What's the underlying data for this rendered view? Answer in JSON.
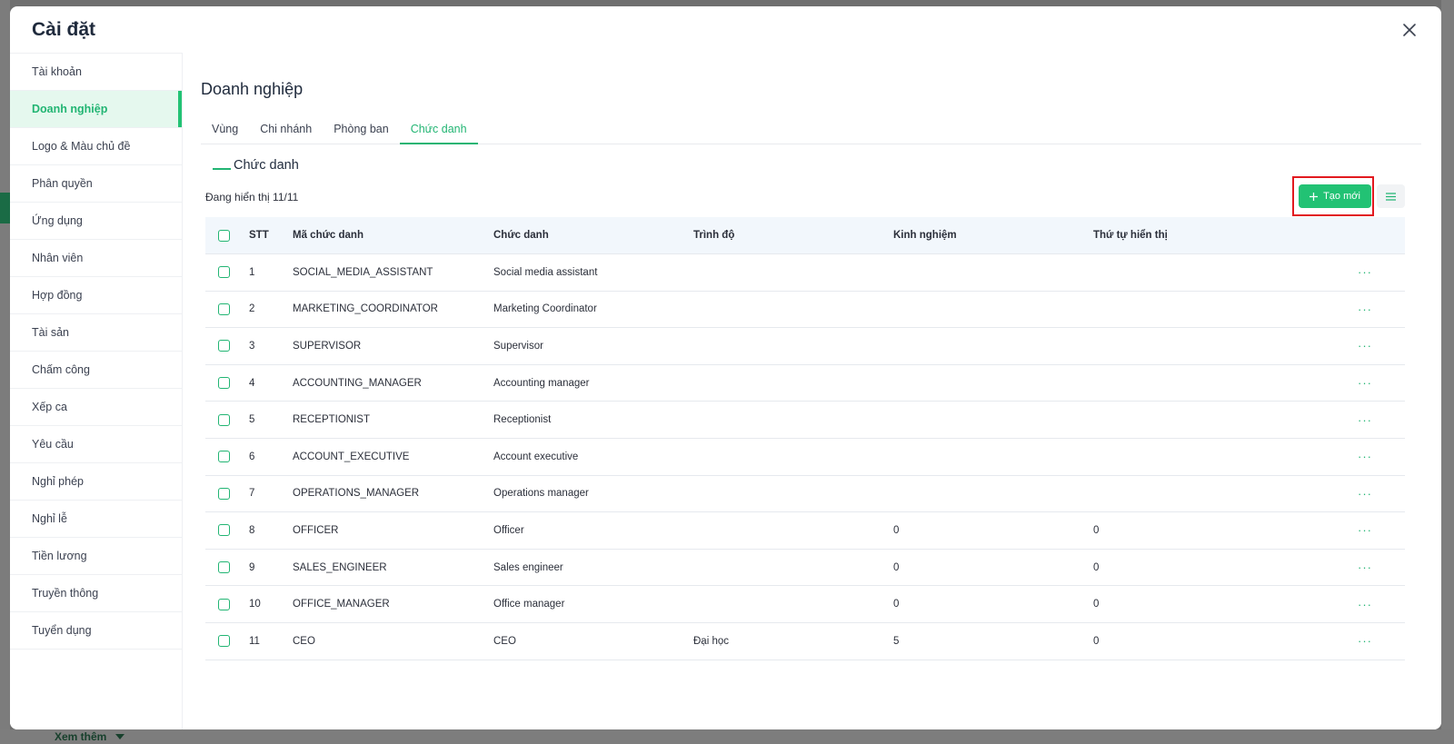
{
  "modal": {
    "title": "Cài đặt"
  },
  "background": {
    "more_label": "Xem thêm"
  },
  "sidebar": {
    "items": [
      {
        "label": "Tài khoản"
      },
      {
        "label": "Doanh nghiệp",
        "active": true
      },
      {
        "label": "Logo & Màu chủ đề"
      },
      {
        "label": "Phân quyền"
      },
      {
        "label": "Ứng dụng"
      },
      {
        "label": "Nhân viên"
      },
      {
        "label": "Hợp đồng"
      },
      {
        "label": "Tài sản"
      },
      {
        "label": "Chấm công"
      },
      {
        "label": "Xếp ca"
      },
      {
        "label": "Yêu cầu"
      },
      {
        "label": "Nghỉ phép"
      },
      {
        "label": "Nghỉ lễ"
      },
      {
        "label": "Tiền lương"
      },
      {
        "label": "Truyền thông"
      },
      {
        "label": "Tuyển dụng"
      }
    ]
  },
  "main": {
    "title": "Doanh nghiệp",
    "tabs": [
      {
        "label": "Vùng"
      },
      {
        "label": "Chi nhánh"
      },
      {
        "label": "Phòng ban"
      },
      {
        "label": "Chức danh",
        "active": true
      }
    ],
    "sub_title": "Chức danh",
    "showing": "Đang hiển thị 11/11",
    "create_label": "Tạo mới"
  },
  "table": {
    "headers": {
      "stt": "STT",
      "code": "Mã chức danh",
      "title": "Chức danh",
      "level": "Trình độ",
      "exp": "Kinh nghiệm",
      "order": "Thứ tự hiển thị"
    },
    "rows": [
      {
        "stt": "1",
        "code": "SOCIAL_MEDIA_ASSISTANT",
        "title": "Social media assistant",
        "level": "",
        "exp": "",
        "order": ""
      },
      {
        "stt": "2",
        "code": "MARKETING_COORDINATOR",
        "title": "Marketing Coordinator",
        "level": "",
        "exp": "",
        "order": ""
      },
      {
        "stt": "3",
        "code": "SUPERVISOR",
        "title": "Supervisor",
        "level": "",
        "exp": "",
        "order": ""
      },
      {
        "stt": "4",
        "code": "ACCOUNTING_MANAGER",
        "title": "Accounting manager",
        "level": "",
        "exp": "",
        "order": ""
      },
      {
        "stt": "5",
        "code": "RECEPTIONIST",
        "title": "Receptionist",
        "level": "",
        "exp": "",
        "order": ""
      },
      {
        "stt": "6",
        "code": "ACCOUNT_EXECUTIVE",
        "title": "Account executive",
        "level": "",
        "exp": "",
        "order": ""
      },
      {
        "stt": "7",
        "code": "OPERATIONS_MANAGER",
        "title": "Operations manager",
        "level": "",
        "exp": "",
        "order": ""
      },
      {
        "stt": "8",
        "code": "OFFICER",
        "title": "Officer",
        "level": "",
        "exp": "0",
        "order": "0"
      },
      {
        "stt": "9",
        "code": "SALES_ENGINEER",
        "title": "Sales engineer",
        "level": "",
        "exp": "0",
        "order": "0"
      },
      {
        "stt": "10",
        "code": "OFFICE_MANAGER",
        "title": "Office manager",
        "level": "",
        "exp": "0",
        "order": "0"
      },
      {
        "stt": "11",
        "code": "CEO",
        "title": "CEO",
        "level": "Đại học",
        "exp": "5",
        "order": "0"
      }
    ],
    "row_action_icon": "more-dots-icon"
  },
  "colors": {
    "accent": "#22c274",
    "highlight": "#e2191f"
  }
}
